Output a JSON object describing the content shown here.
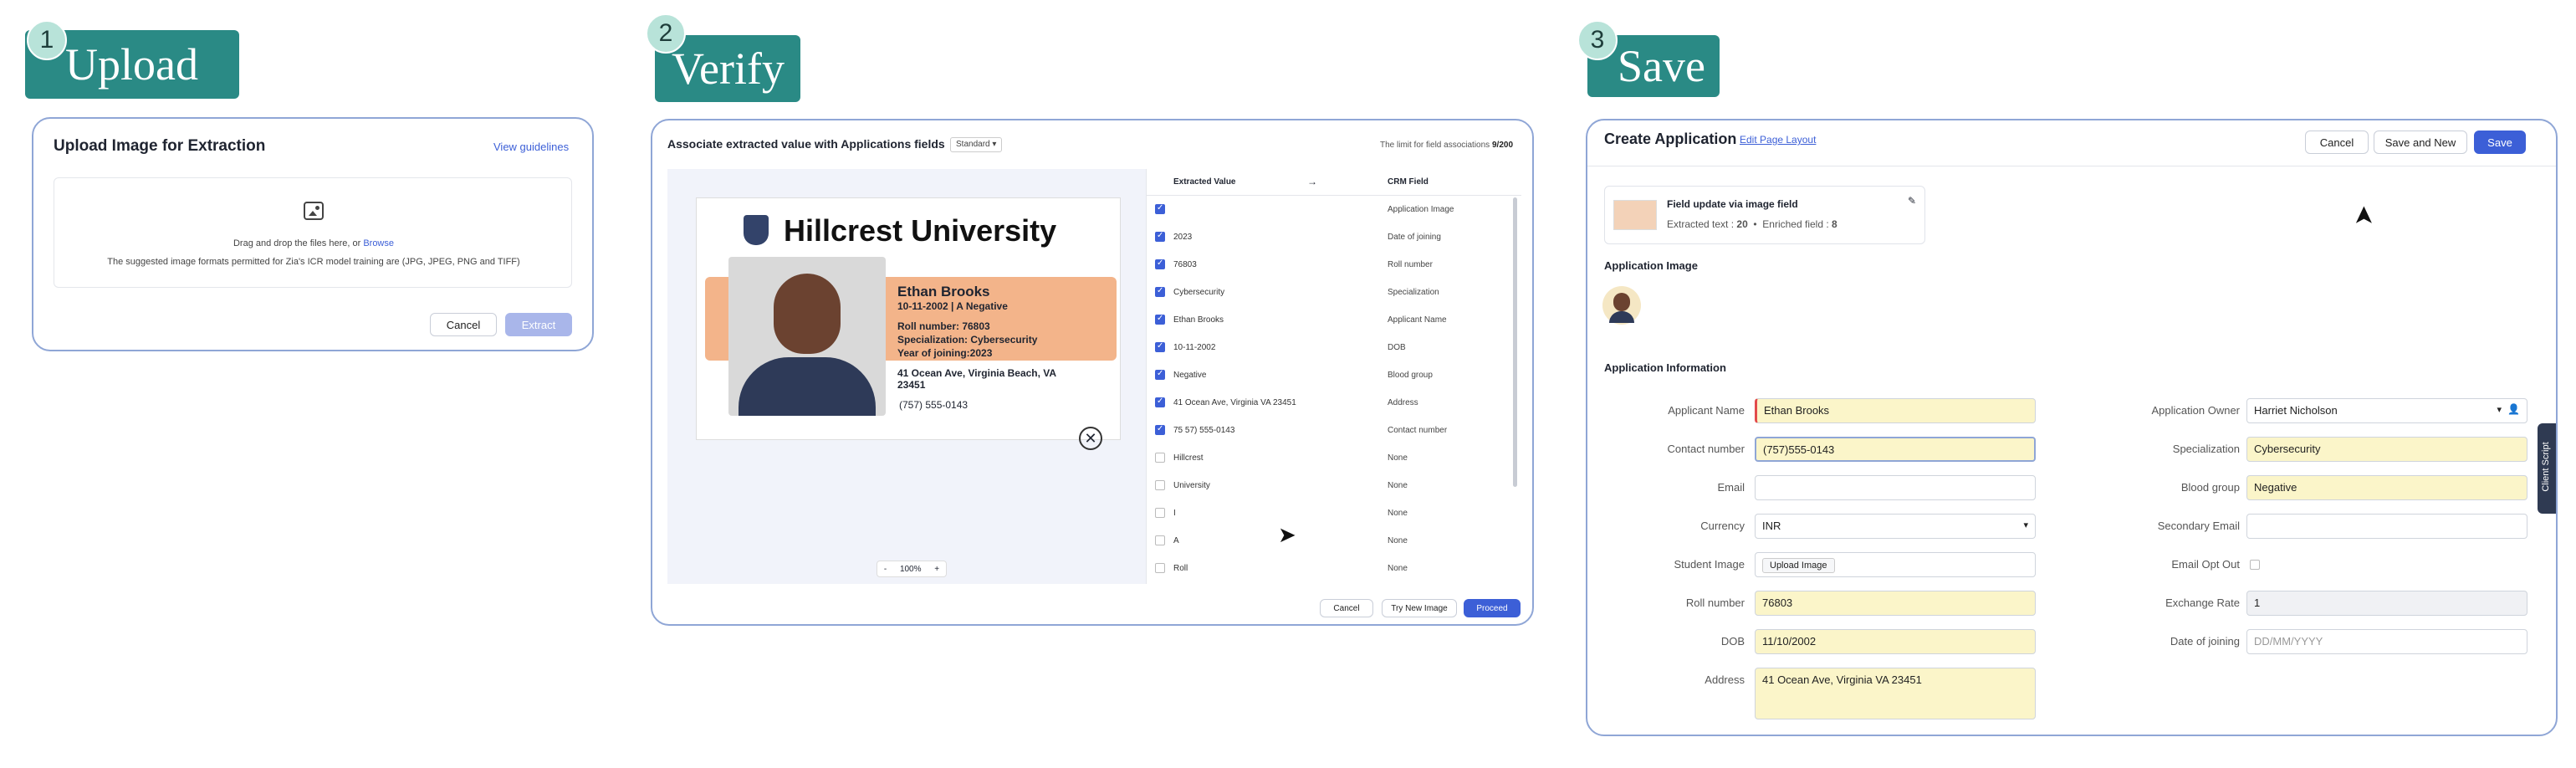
{
  "steps": [
    {
      "num": "1",
      "label": "Upload"
    },
    {
      "num": "2",
      "label": "Verify"
    },
    {
      "num": "3",
      "label": "Save"
    }
  ],
  "upload": {
    "title": "Upload Image for Extraction",
    "guidelines_link": "View guidelines",
    "drag_text": "Drag and drop the files here, or",
    "browse_link": "Browse",
    "formats_text": "The suggested image formats permitted for Zia's ICR model training are (JPG, JPEG, PNG and TIFF)",
    "cancel": "Cancel",
    "extract": "Extract"
  },
  "verify": {
    "title": "Associate extracted value with Applications fields",
    "dropdown": "Standard",
    "limit_text": "The limit for field associations",
    "limit_value": "9/200",
    "col_extracted": "Extracted Value",
    "col_crm": "CRM Field",
    "zoom": "100%",
    "zoom_minus": "-",
    "zoom_plus": "+",
    "id_card": {
      "university_word1": "Hillcrest",
      "university_word2": "University",
      "name": "Ethan Brooks",
      "dob_line": "10-11-2002 | A Negative",
      "roll": "Roll number: 76803",
      "spec": "Specialization: Cybersecurity",
      "year": "Year of joining:2023",
      "address": "41 Ocean Ave, Virginia Beach, VA 23451",
      "phone": "(757) 555-0143"
    },
    "rows": [
      {
        "value": "",
        "field": "Application Image",
        "checked": true
      },
      {
        "value": "2023",
        "field": "Date of joining",
        "checked": true
      },
      {
        "value": "76803",
        "field": "Roll number",
        "checked": true
      },
      {
        "value": "Cybersecurity",
        "field": "Specialization",
        "checked": true
      },
      {
        "value": "Ethan Brooks",
        "field": "Applicant Name",
        "checked": true
      },
      {
        "value": "10-11-2002",
        "field": "DOB",
        "checked": true
      },
      {
        "value": "Negative",
        "field": "Blood group",
        "checked": true
      },
      {
        "value": "41 Ocean Ave, Virginia VA 23451",
        "field": "Address",
        "checked": true
      },
      {
        "value": "75 57) 555-0143",
        "field": "Contact number",
        "checked": true
      },
      {
        "value": "Hillcrest",
        "field": "None",
        "checked": false
      },
      {
        "value": "University",
        "field": "None",
        "checked": false
      },
      {
        "value": "I",
        "field": "None",
        "checked": false
      },
      {
        "value": "A",
        "field": "None",
        "checked": false
      },
      {
        "value": "Roll",
        "field": "None",
        "checked": false
      }
    ],
    "cancel": "Cancel",
    "try_new": "Try New Image",
    "proceed": "Proceed"
  },
  "save": {
    "title": "Create Application",
    "edit_layout": "Edit Page Layout",
    "cancel": "Cancel",
    "save_new": "Save and New",
    "save": "Save",
    "field_update_title": "Field update via image field",
    "extracted_label": "Extracted text :",
    "extracted_count": "20",
    "enriched_label": "Enriched field :",
    "enriched_count": "8",
    "section_image": "Application Image",
    "section_info": "Application Information",
    "client_script": "Client Script",
    "left_fields": [
      {
        "label": "Applicant Name",
        "value": "Ethan Brooks",
        "filled": true
      },
      {
        "label": "Contact number",
        "value": "(757)555-0143",
        "filled": true
      },
      {
        "label": "Email",
        "value": "",
        "filled": false
      },
      {
        "label": "Currency",
        "value": "INR",
        "filled": false
      },
      {
        "label": "Student Image",
        "value": "Upload Image",
        "filled": false
      },
      {
        "label": "Roll number",
        "value": "76803",
        "filled": true
      },
      {
        "label": "DOB",
        "value": "11/10/2002",
        "filled": true
      },
      {
        "label": "Address",
        "value": "41 Ocean Ave, Virginia VA 23451",
        "filled": true
      }
    ],
    "right_fields": [
      {
        "label": "Application Owner",
        "value": "Harriet Nicholson",
        "filled": false
      },
      {
        "label": "Specialization",
        "value": "Cybersecurity",
        "filled": true
      },
      {
        "label": "Blood group",
        "value": "Negative",
        "filled": true
      },
      {
        "label": "Secondary Email",
        "value": "",
        "filled": false
      },
      {
        "label": "Email Opt Out",
        "value": "",
        "filled": false
      },
      {
        "label": "Exchange Rate",
        "value": "1",
        "filled": false
      },
      {
        "label": "Date of joining",
        "value": "DD/MM/YYYY",
        "filled": false
      }
    ]
  },
  "colors": {
    "accent": "#3c5fd7",
    "tag": "#2a8a85",
    "filled": "#fbf5c9",
    "id_band": "#f3b48a"
  }
}
